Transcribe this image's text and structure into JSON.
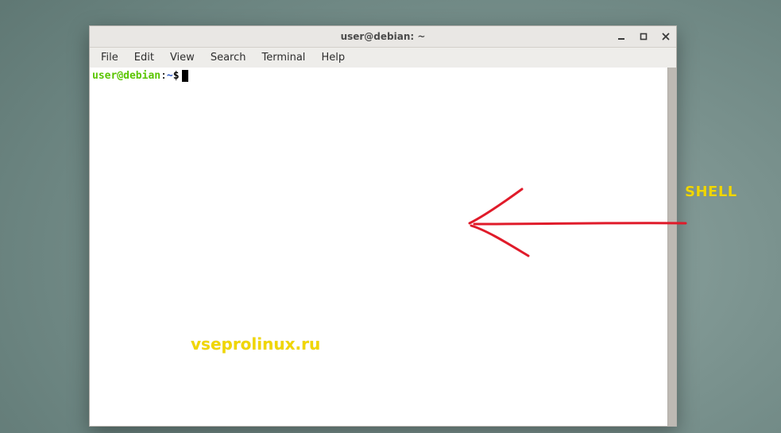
{
  "window": {
    "title": "user@debian: ~"
  },
  "menubar": {
    "items": [
      "File",
      "Edit",
      "View",
      "Search",
      "Terminal",
      "Help"
    ]
  },
  "terminal": {
    "prompt_user_host": "user@debian",
    "prompt_separator": ":",
    "prompt_path": "~",
    "prompt_symbol": "$"
  },
  "annotation": {
    "label": "SHELL",
    "arrow_color": "#e01b2a"
  },
  "watermark": "vseprolinux.ru"
}
